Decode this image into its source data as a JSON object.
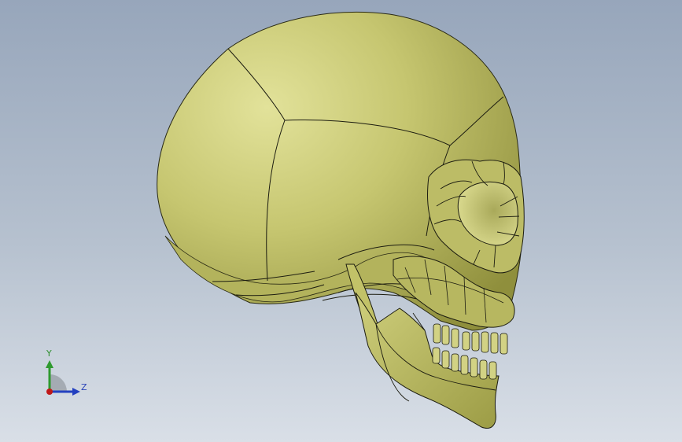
{
  "viewport": {
    "background_top": "#97a6bb",
    "background_bottom": "#d9dfe7",
    "model": {
      "subject": "skull",
      "fill_color": "#c5c56a",
      "edge_color": "#1c1c10"
    }
  },
  "triad": {
    "y_label": "Y",
    "z_label": "Z",
    "y_color": "#2f9a2f",
    "z_color": "#2340c0",
    "x_color": "#c01818"
  }
}
